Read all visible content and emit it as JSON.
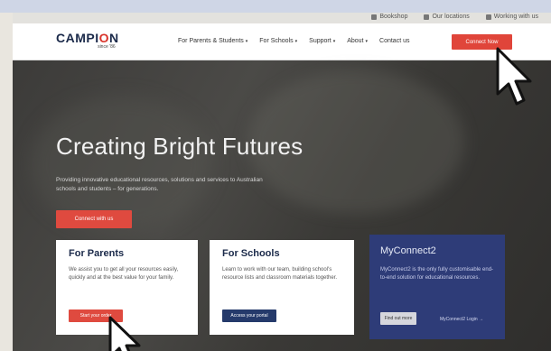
{
  "utility_bar": {
    "links": [
      "Bookshop",
      "Our locations",
      "Working with us"
    ]
  },
  "header": {
    "logo_main_a": "CAMPI",
    "logo_main_b": "O",
    "logo_main_c": "N",
    "logo_sub": "since '86",
    "nav": [
      {
        "label": "For Parents & Students"
      },
      {
        "label": "For Schools"
      },
      {
        "label": "Support"
      },
      {
        "label": "About"
      },
      {
        "label": "Contact us"
      }
    ],
    "cta_label": "Connect Now"
  },
  "hero": {
    "headline": "Creating Bright Futures",
    "subtext": "Providing innovative educational resources, solutions and services to Australian schools and students – for generations.",
    "cta_label": "Connect with us"
  },
  "cards": {
    "parents": {
      "title": "For Parents",
      "body": "We assist you to get all your resources easily, quickly and at the best value for your family.",
      "button": "Start your order"
    },
    "schools": {
      "title": "For Schools",
      "body": "Learn to work with our team, building school's resource lists and classroom materials together.",
      "button": "Access your portal"
    },
    "myconnect": {
      "title": "MyConnect2",
      "body": "MyConnect2 is the only fully customisable end-to-end solution for educational resources.",
      "button": "Find out more",
      "link": "MyConnect2 Login →"
    }
  },
  "colors": {
    "accent": "#df4a3f",
    "navy": "#1b2a4a",
    "myconnect_bg": "#2e3c78"
  }
}
